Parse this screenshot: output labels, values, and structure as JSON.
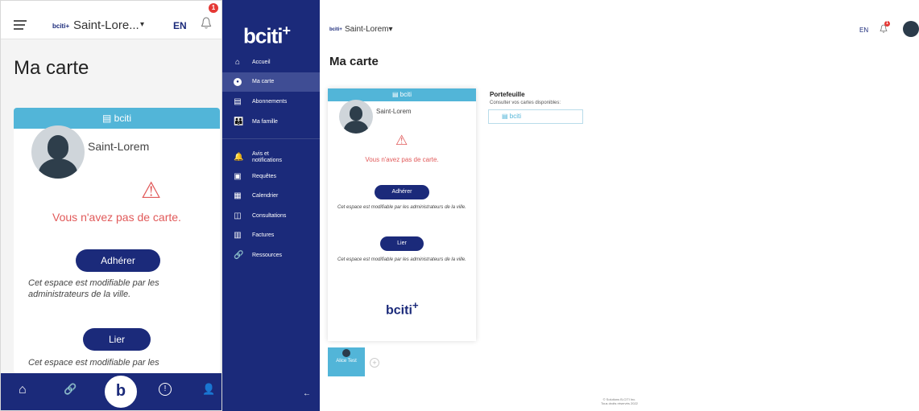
{
  "mobile": {
    "header": {
      "logo": "bciti+",
      "city": "Saint-Lore...",
      "chevron": "▾",
      "lang": "EN",
      "notif_count": "1"
    },
    "title": "Ma carte",
    "card": {
      "header": "bciti",
      "name": "Saint-Lorem",
      "warning_icon": "⚠",
      "no_card": "Vous n'avez pas de carte.",
      "adherer": "Adhérer",
      "note1": "Cet espace est modifiable par les administrateurs de la ville.",
      "lier": "Lier",
      "note2": "Cet espace est modifiable par les"
    },
    "bottom_nav": {
      "home": "⌂",
      "link": "🔗",
      "center": "b",
      "alert": "!",
      "user": "👤"
    }
  },
  "sidebar": {
    "logo": "bciti",
    "logo_plus": "+",
    "items": [
      {
        "icon": "⌂",
        "label": "Accueil"
      },
      {
        "icon": "●",
        "label": "Ma carte"
      },
      {
        "icon": "▤",
        "label": "Abonnements"
      },
      {
        "icon": "👪",
        "label": "Ma famille"
      },
      {
        "icon": "🔔",
        "label": "Avis et notifications"
      },
      {
        "icon": "▣",
        "label": "Requêtes"
      },
      {
        "icon": "▦",
        "label": "Calendrier"
      },
      {
        "icon": "◫",
        "label": "Consultations"
      },
      {
        "icon": "▥",
        "label": "Factures"
      },
      {
        "icon": "🔗",
        "label": "Ressources"
      }
    ],
    "back": "←"
  },
  "desktop": {
    "header": {
      "logo": "bciti+",
      "city": "Saint-Lorem",
      "chevron": "▾",
      "lang": "EN",
      "notif_count": "1"
    },
    "title": "Ma carte",
    "card": {
      "header": "bciti",
      "name": "Saint-Lorem",
      "warning_icon": "⚠",
      "no_card": "Vous n'avez pas de carte.",
      "adherer": "Adhérer",
      "note1": "Cet espace est modifiable par les administrateurs de la ville.",
      "lier": "Lier",
      "note2": "Cet espace est modifiable par les administrateurs de la ville.",
      "logo": "bciti",
      "logo_plus": "+"
    },
    "portefeuille": {
      "title": "Portefeuille",
      "subtitle": "Consulter vos cartes disponibles:",
      "card_label": "bciti"
    },
    "family": {
      "member": "Alice Test",
      "add": "+"
    },
    "footer": {
      "line1": "© Solutions B-CITI Inc.",
      "line2": "Tous droits réservés 2022"
    }
  },
  "colors": {
    "navy": "#1b2a7a",
    "cyan": "#52b5d8",
    "warning_red": "#e15a5a"
  }
}
